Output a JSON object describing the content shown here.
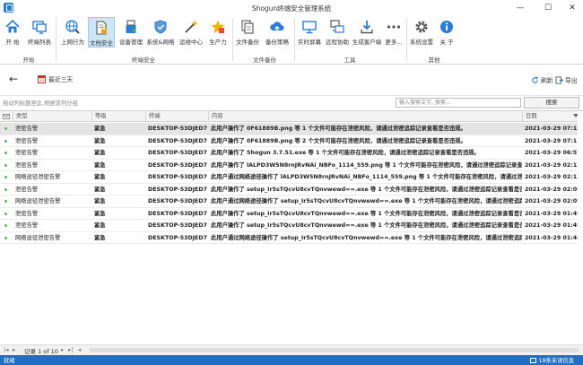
{
  "window": {
    "title": "Shogun终端安全管理系统"
  },
  "ribbon": {
    "buttons": [
      {
        "label": "开 始"
      },
      {
        "label": "终端列表"
      },
      {
        "label": "上网行为"
      },
      {
        "label": "文档安全"
      },
      {
        "label": "设备管理"
      },
      {
        "label": "系统&网络"
      },
      {
        "label": "运维中心"
      },
      {
        "label": "生产力"
      },
      {
        "label": "文件备份"
      },
      {
        "label": "备份策略"
      },
      {
        "label": "实时屏幕"
      },
      {
        "label": "远程协助"
      },
      {
        "label": "生成客户端"
      },
      {
        "label": "更多..."
      },
      {
        "label": "系统设置"
      },
      {
        "label": "关 于"
      }
    ],
    "groups": [
      "开始",
      "终端安全",
      "文件备份",
      "工具",
      "其他"
    ]
  },
  "toolbar": {
    "date_range": "最近三天",
    "refresh": "刷新",
    "export": "导出"
  },
  "grouping_hint": "拖动列标题至此,根据该列分组",
  "search": {
    "placeholder": "输入搜索文字, 搜索...",
    "button": "搜索"
  },
  "table": {
    "columns": [
      "类型",
      "等级",
      "终端",
      "内容",
      "日期"
    ],
    "rows": [
      {
        "type": "泄密告警",
        "level": "紧急",
        "terminal": "DESKTOP-53DJED7",
        "content": "此用户操作了 0F61889B.png 等 1 个文件可能存在泄密风险，请通过泄密追踪记录查看是否违规。",
        "date": "2021-03-29 07:12:18"
      },
      {
        "type": "泄密告警",
        "level": "紧急",
        "terminal": "DESKTOP-53DJED7",
        "content": "此用户操作了 0F61889B.png 等 2 个文件可能存在泄密风险，请通过泄密追踪记录查看是否违规。",
        "date": "2021-03-29 07:11:27"
      },
      {
        "type": "泄密告警",
        "level": "紧急",
        "terminal": "DESKTOP-53DJED7",
        "content": "此用户操作了 Shogun 3.7.51.exe 等 1 个文件可能存在泄密风险，请通过泄密追踪记录查看是否违规。",
        "date": "2021-03-29 06:57:15"
      },
      {
        "type": "泄密告警",
        "level": "紧急",
        "terminal": "DESKTOP-53DJED7",
        "content": "此用户操作了 lALPD3W5N8rnJRvNAi_NBFo_1114_559.png 等 1 个文件可能存在泄密风险，请通过泄密追踪记录查看是否违规。",
        "date": "2021-03-29 02:12:36"
      },
      {
        "type": "网络途径泄密告警",
        "level": "紧急",
        "terminal": "DESKTOP-53DJED7",
        "content": "此用户通过网络途径操作了 lALPD3W5N8rnJRvNAi_NBFo_1114_559.png 等 1 个文件可能存在泄密风险，请通过泄密追踪记录查看是否违规。",
        "date": "2021-03-29 02:12:36"
      },
      {
        "type": "泄密告警",
        "level": "紧急",
        "terminal": "DESKTOP-53DJED7",
        "content": "此用户操作了 setup_Ir5sTQcvU8cvTQnvwewd==.exe 等 1 个文件可能存在泄密风险，请通过泄密追踪记录查看是否违规。",
        "date": "2021-03-29 02:09:25"
      },
      {
        "type": "网络途径泄密告警",
        "level": "紧急",
        "terminal": "DESKTOP-53DJED7",
        "content": "此用户通过网络途径操作了 setup_Ir5sTQcvU8cvTQnvwewd==.exe 等 1 个文件可能存在泄密风险，请通过泄密追踪记录查看是否违规。",
        "date": "2021-03-29 02:09:58"
      },
      {
        "type": "泄密告警",
        "level": "紧急",
        "terminal": "DESKTOP-53DJED7",
        "content": "此用户操作了 setup_Ir5sTQcvU8cvTQnvwewd==.exe 等 1 个文件可能存在泄密风险，请通过泄密追踪记录查看是否违规。",
        "date": "2021-03-29 01:49:42"
      },
      {
        "type": "泄密告警",
        "level": "紧急",
        "terminal": "DESKTOP-53DJED7",
        "content": "此用户操作了 setup_Ir5sTQcvU8cvTQnvwewd==.exe 等 1 个文件可能存在泄密风险，请通过泄密追踪记录查看是否违规。",
        "date": "2021-03-29 01:49:15"
      },
      {
        "type": "网络途径泄密告警",
        "level": "紧急",
        "terminal": "DESKTOP-53DJED7",
        "content": "此用户通过网络途径操作了 setup_Ir5sTQcvU8cvTQnvwewd==.exe 等 1 个文件可能存在泄密风险，请通过泄密追踪记录...",
        "date": "2021-03-29 01:48:47"
      }
    ]
  },
  "pager": {
    "record_text": "记录 1 of 10"
  },
  "status": {
    "left": "就绪",
    "right": "18条未读信息"
  },
  "colors": {
    "accent": "#1f6fc5",
    "active_tab": "#cde6f7",
    "selected_row": "#e4e4e4",
    "ok_dot": "#5cb85c"
  }
}
